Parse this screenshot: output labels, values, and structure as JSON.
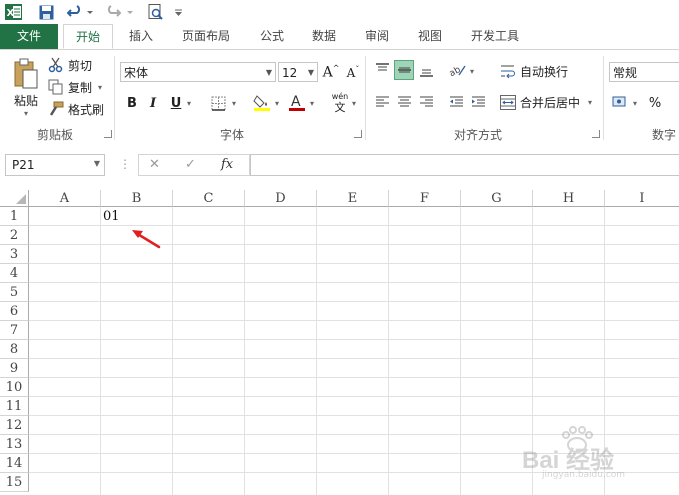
{
  "quick_access": {
    "icons": [
      "excel-logo-icon",
      "save-icon",
      "undo-icon",
      "redo-icon",
      "print-preview-icon",
      "customize-qat-icon"
    ]
  },
  "tabs": [
    {
      "label": "文件"
    },
    {
      "label": "开始"
    },
    {
      "label": "插入"
    },
    {
      "label": "页面布局"
    },
    {
      "label": "公式"
    },
    {
      "label": "数据"
    },
    {
      "label": "审阅"
    },
    {
      "label": "视图"
    },
    {
      "label": "开发工具"
    }
  ],
  "ribbon": {
    "clipboard": {
      "paste_label": "粘贴",
      "cut_label": "剪切",
      "copy_label": "复制",
      "format_painter_label": "格式刷",
      "group_label": "剪贴板"
    },
    "font": {
      "font_name": "宋体",
      "font_size": "12",
      "bold": "B",
      "italic": "I",
      "underline": "U",
      "phonetic_top": "wén",
      "phonetic_bottom": "文",
      "group_label": "字体",
      "fill_color": "#ffff00",
      "font_color": "#c00000"
    },
    "alignment": {
      "wrap_text_label": "自动换行",
      "merge_center_label": "合并后居中",
      "group_label": "对齐方式"
    },
    "number": {
      "format_value": "常规",
      "percent": "%",
      "group_label": "数字"
    }
  },
  "formula_bar": {
    "name_box": "P21",
    "cancel_glyph": "✕",
    "enter_glyph": "✓",
    "fx_label": "fx",
    "formula_value": ""
  },
  "sheet": {
    "columns": [
      "A",
      "B",
      "C",
      "D",
      "E",
      "F",
      "G",
      "H",
      "I"
    ],
    "rows": [
      "1",
      "2",
      "3",
      "4",
      "5",
      "6",
      "7",
      "8",
      "9",
      "10",
      "11",
      "12",
      "13",
      "14",
      "15"
    ],
    "cells": {
      "B1": "01"
    }
  },
  "watermark": {
    "text": "Bai 经验",
    "url_text": "jingyan.baidu.com"
  },
  "colors": {
    "excel_green": "#217346",
    "selected_align": "#9fd5b7",
    "arrow_red": "#e02020"
  }
}
